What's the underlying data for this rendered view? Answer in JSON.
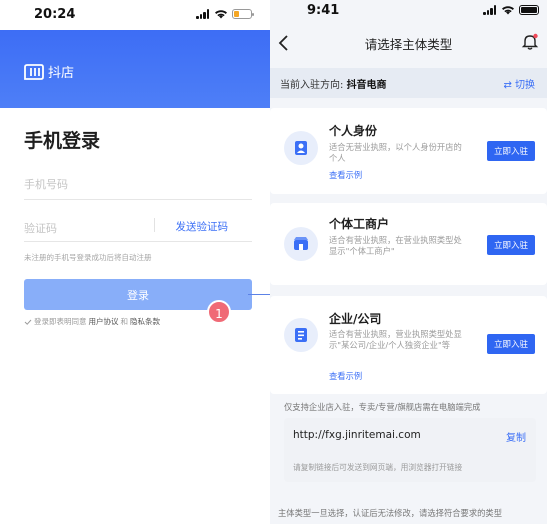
{
  "login_screen": {
    "status_time": "20:24",
    "app_name": "抖店",
    "title": "手机登录",
    "phone_placeholder": "手机号码",
    "code_placeholder": "验证码",
    "send_code_label": "发送验证码",
    "hint": "未注册的手机号登录成功后将自动注册",
    "login_button": "登录",
    "agree_prefix": "登录即表明同意",
    "user_agreement": "用户协议",
    "and_text": "和",
    "privacy_policy": "隐私条款",
    "annotation_badge": "1"
  },
  "select_screen": {
    "status_time": "9:41",
    "nav_title": "请选择主体类型",
    "direction_label": "当前入驻方向:",
    "direction_value": "抖音电商",
    "switch_label": "⇄ 切换",
    "cards": [
      {
        "title": "个人身份",
        "desc": "适合无营业执照，以个人身份开店的个人",
        "example": "查看示例",
        "button": "立即入驻"
      },
      {
        "title": "个体工商户",
        "desc": "适合有营业执照，在营业执照类型处显示\"个体工商户\"",
        "button": "立即入驻"
      },
      {
        "title": "企业/公司",
        "desc": "适合有营业执照，营业执照类型处显示\"某公司/企业/个人独资企业\"等",
        "example": "查看示例",
        "button": "立即入驻"
      }
    ],
    "note_enterprise": "仅支持企业店入驻，专卖/专营/旗舰店需在电脑端完成",
    "url": "http://fxg.jinritemai.com",
    "copy_label": "复制",
    "url_tip": "请复制链接后可发送到网页端，用浏览器打开链接",
    "note_bottom": "主体类型一旦选择，认证后无法修改，请选择符合要求的类型"
  },
  "colors": {
    "brand_blue": "#3b6ff6",
    "header_blue": "#4e7ff7",
    "login_button_disabled": "#88aef9",
    "badge_red": "#f06a76"
  }
}
